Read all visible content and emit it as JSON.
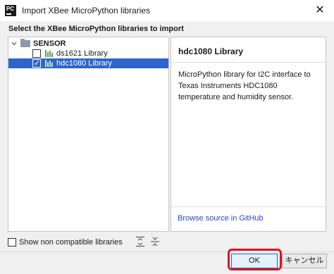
{
  "window": {
    "title": "Import XBee MicroPython libraries",
    "app_icon_text": "PC",
    "close_glyph": "✕"
  },
  "heading": "Select the XBee MicroPython libraries to import",
  "tree": {
    "folder": {
      "label": "SENSOR",
      "expanded": true,
      "icon": "folder-icon"
    },
    "items": [
      {
        "label": "ds1621 Library",
        "checked": false,
        "selected": false
      },
      {
        "label": "hdc1080 Library",
        "checked": true,
        "selected": true
      }
    ]
  },
  "details": {
    "title": "hdc1080 Library",
    "description": "MicroPython library for I2C interface to Texas Instruments HDC1080 temperature and humidity sensor.",
    "link": "Browse source in GitHub"
  },
  "options": {
    "show_non_compatible_label": "Show non compatible libraries",
    "show_non_compatible_checked": false
  },
  "toolbar": {
    "icons": [
      "expand-all-icon",
      "collapse-all-icon"
    ]
  },
  "buttons": {
    "ok": "OK",
    "cancel": "キャンセル"
  },
  "colors": {
    "selection": "#2f65ca",
    "link": "#2a46c8",
    "highlight": "#e0141e"
  }
}
